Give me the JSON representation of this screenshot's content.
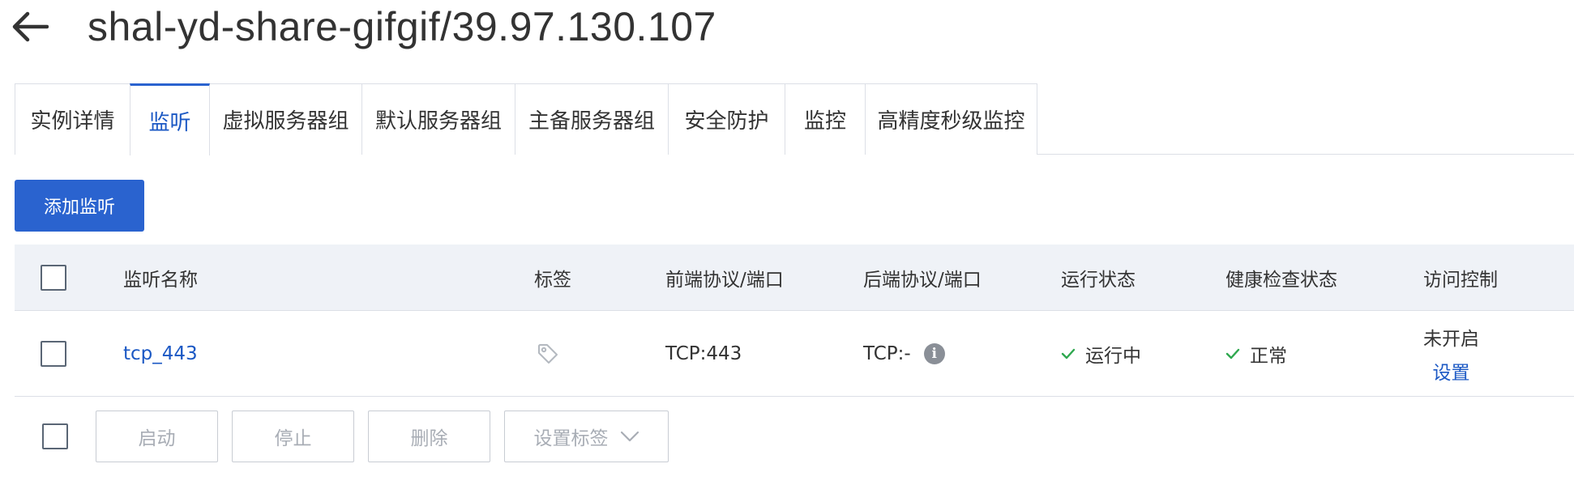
{
  "header": {
    "back_icon": "arrow-left-icon",
    "title": "shal-yd-share-gifgif/39.97.130.107"
  },
  "tabs": [
    {
      "label": "实例详情",
      "active": false
    },
    {
      "label": "监听",
      "active": true
    },
    {
      "label": "虚拟服务器组",
      "active": false
    },
    {
      "label": "默认服务器组",
      "active": false
    },
    {
      "label": "主备服务器组",
      "active": false
    },
    {
      "label": "安全防护",
      "active": false
    },
    {
      "label": "监控",
      "active": false
    },
    {
      "label": "高精度秒级监控",
      "active": false
    }
  ],
  "toolbar": {
    "add_listener_label": "添加监听"
  },
  "table": {
    "columns": [
      "监听名称",
      "标签",
      "前端协议/端口",
      "后端协议/端口",
      "运行状态",
      "健康检查状态",
      "访问控制"
    ],
    "rows": [
      {
        "name": "tcp_443",
        "tag_icon": "tag-icon",
        "frontend": "TCP:443",
        "backend": "TCP:-",
        "backend_info_icon": "info-icon",
        "run_status": "运行中",
        "health_status": "正常",
        "access_control": "未开启",
        "access_control_action": "设置"
      }
    ]
  },
  "batch_actions": {
    "start": "启动",
    "stop": "停止",
    "delete": "删除",
    "set_tags": "设置标签"
  },
  "colors": {
    "accent": "#2a63cf",
    "link": "#1b58c4",
    "success": "#2fa84f",
    "header_bg": "#eff2f7",
    "border": "#dcdfe6"
  }
}
